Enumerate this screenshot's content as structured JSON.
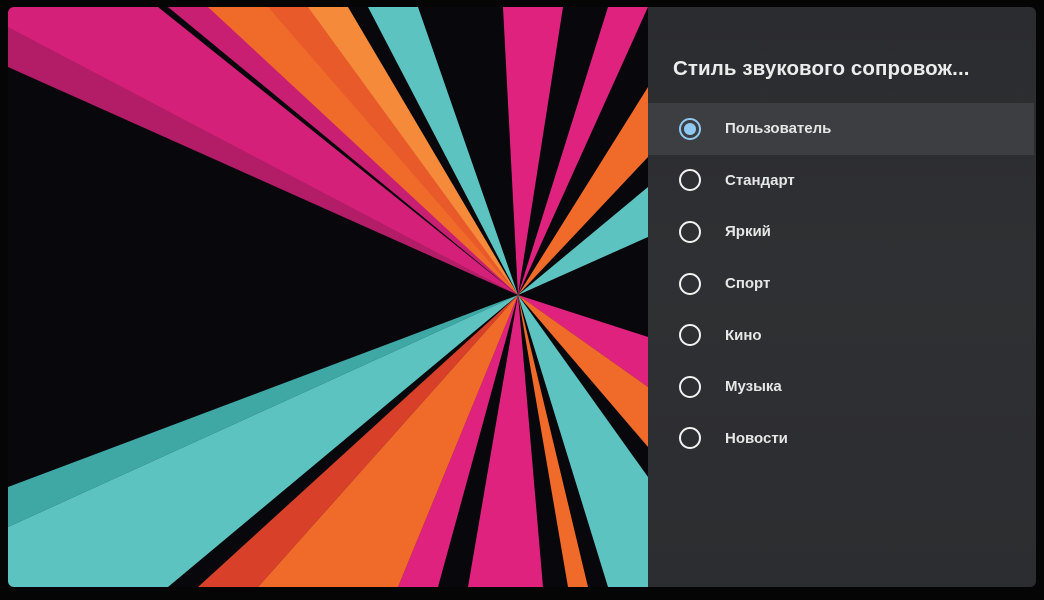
{
  "panel": {
    "title": "Стиль звукового сопровож...",
    "selected_index": 0,
    "options": [
      {
        "label": "Пользователь",
        "selected": true
      },
      {
        "label": "Стандарт",
        "selected": false
      },
      {
        "label": "Яркий",
        "selected": false
      },
      {
        "label": "Спорт",
        "selected": false
      },
      {
        "label": "Кино",
        "selected": false
      },
      {
        "label": "Музыка",
        "selected": false
      },
      {
        "label": "Новости",
        "selected": false
      }
    ]
  },
  "colors": {
    "accent": "#8fc9f2",
    "panel_bg": "#2e2f32",
    "selected_row_bg": "#3d3e42",
    "wallpaper_pink": "#e0227f",
    "wallpaper_orange": "#f06a2a",
    "wallpaper_teal": "#5cc3c0",
    "wallpaper_bg": "#07070c"
  }
}
